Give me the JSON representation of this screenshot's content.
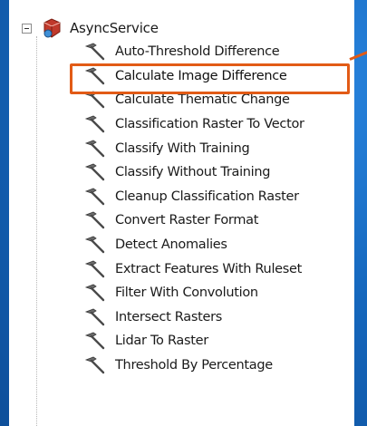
{
  "tree": {
    "root": {
      "label": "AsyncService",
      "icon": "service-toolbox-icon",
      "expander_state": "expanded"
    },
    "items": [
      {
        "label": "Auto-Threshold Difference",
        "icon": "hammer-icon"
      },
      {
        "label": "Calculate Image Difference",
        "icon": "hammer-icon",
        "highlighted": true
      },
      {
        "label": "Calculate Thematic Change",
        "icon": "hammer-icon"
      },
      {
        "label": "Classification Raster To Vector",
        "icon": "hammer-icon"
      },
      {
        "label": "Classify With Training",
        "icon": "hammer-icon"
      },
      {
        "label": "Classify Without Training",
        "icon": "hammer-icon"
      },
      {
        "label": "Cleanup Classification Raster",
        "icon": "hammer-icon"
      },
      {
        "label": "Convert Raster Format",
        "icon": "hammer-icon"
      },
      {
        "label": "Detect Anomalies",
        "icon": "hammer-icon"
      },
      {
        "label": "Extract Features With Ruleset",
        "icon": "hammer-icon"
      },
      {
        "label": "Filter With Convolution",
        "icon": "hammer-icon"
      },
      {
        "label": "Intersect Rasters",
        "icon": "hammer-icon"
      },
      {
        "label": "Lidar To Raster",
        "icon": "hammer-icon"
      },
      {
        "label": "Threshold By Percentage",
        "icon": "hammer-icon"
      }
    ]
  },
  "colors": {
    "background": "#1565b8",
    "highlight_box": "#e25b16",
    "panel": "#ffffff"
  }
}
